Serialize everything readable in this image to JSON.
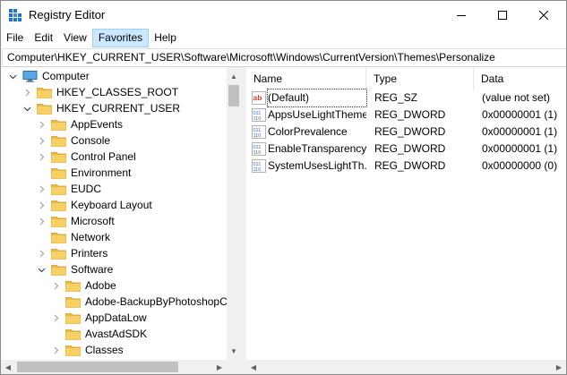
{
  "window": {
    "title": "Registry Editor"
  },
  "menu": [
    "File",
    "Edit",
    "View",
    "Favorites",
    "Help"
  ],
  "menu_active": "Favorites",
  "address": "Computer\\HKEY_CURRENT_USER\\Software\\Microsoft\\Windows\\CurrentVersion\\Themes\\Personalize",
  "tree": [
    {
      "label": "Computer",
      "level": 0,
      "expanded": true,
      "icon": "computer-icon"
    },
    {
      "label": "HKEY_CLASSES_ROOT",
      "level": 1,
      "expanded": false,
      "icon": "folder-icon"
    },
    {
      "label": "HKEY_CURRENT_USER",
      "level": 1,
      "expanded": true,
      "icon": "folder-icon"
    },
    {
      "label": "AppEvents",
      "level": 2,
      "expanded": false,
      "icon": "folder-icon"
    },
    {
      "label": "Console",
      "level": 2,
      "expanded": false,
      "icon": "folder-icon"
    },
    {
      "label": "Control Panel",
      "level": 2,
      "expanded": false,
      "icon": "folder-icon"
    },
    {
      "label": "Environment",
      "level": 2,
      "expanded": null,
      "icon": "folder-icon"
    },
    {
      "label": "EUDC",
      "level": 2,
      "expanded": false,
      "icon": "folder-icon"
    },
    {
      "label": "Keyboard Layout",
      "level": 2,
      "expanded": false,
      "icon": "folder-icon"
    },
    {
      "label": "Microsoft",
      "level": 2,
      "expanded": false,
      "icon": "folder-icon"
    },
    {
      "label": "Network",
      "level": 2,
      "expanded": null,
      "icon": "folder-icon"
    },
    {
      "label": "Printers",
      "level": 2,
      "expanded": false,
      "icon": "folder-icon"
    },
    {
      "label": "Software",
      "level": 2,
      "expanded": true,
      "icon": "folder-icon"
    },
    {
      "label": "Adobe",
      "level": 3,
      "expanded": false,
      "icon": "folder-icon"
    },
    {
      "label": "Adobe-BackupByPhotoshopC",
      "level": 3,
      "expanded": null,
      "icon": "folder-icon"
    },
    {
      "label": "AppDataLow",
      "level": 3,
      "expanded": false,
      "icon": "folder-icon"
    },
    {
      "label": "AvastAdSDK",
      "level": 3,
      "expanded": null,
      "icon": "folder-icon"
    },
    {
      "label": "Classes",
      "level": 3,
      "expanded": false,
      "icon": "folder-icon"
    }
  ],
  "columns": [
    "Name",
    "Type",
    "Data"
  ],
  "values": [
    {
      "name": "(Default)",
      "type": "REG_SZ",
      "data": "(value not set)",
      "icon": "string-value-icon"
    },
    {
      "name": "AppsUseLightTheme",
      "type": "REG_DWORD",
      "data": "0x00000001 (1)",
      "icon": "binary-value-icon"
    },
    {
      "name": "ColorPrevalence",
      "type": "REG_DWORD",
      "data": "0x00000001 (1)",
      "icon": "binary-value-icon"
    },
    {
      "name": "EnableTransparency",
      "type": "REG_DWORD",
      "data": "0x00000001 (1)",
      "icon": "binary-value-icon"
    },
    {
      "name": "SystemUsesLightTh...",
      "type": "REG_DWORD",
      "data": "0x00000000 (0)",
      "icon": "binary-value-icon"
    }
  ],
  "colors": {
    "folder": "#e8b84a",
    "folder_dark": "#d49b1f",
    "selection": "#cce8ff",
    "string_icon": "#d04040",
    "binary_icon": "#3a6bc4"
  }
}
